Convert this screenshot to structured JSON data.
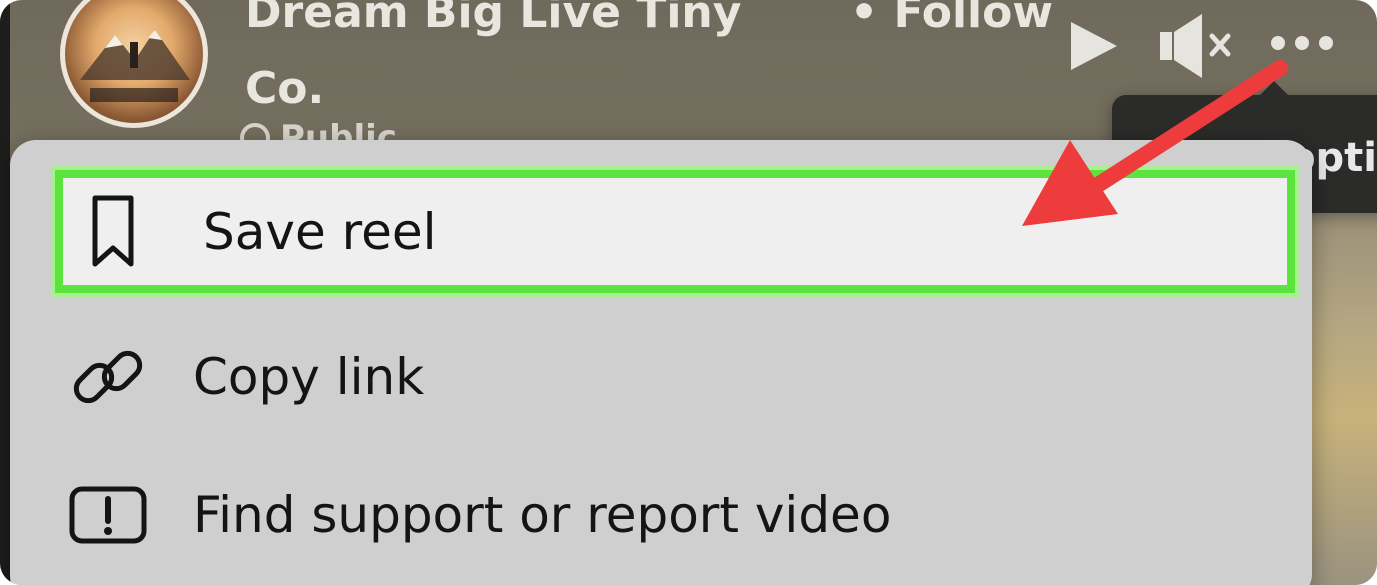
{
  "post_header": {
    "page_name": "Dream Big Live Tiny\nCo.",
    "follow_label": "• Follow",
    "audience": "Public"
  },
  "controls": {
    "play_icon": "play-icon",
    "mute_icon": "muted-speaker-icon",
    "more_icon": "more-options-icon"
  },
  "tooltip": {
    "text": "More options"
  },
  "menu": {
    "items": [
      {
        "label": "Save reel",
        "icon": "bookmark-icon",
        "highlighted": true
      },
      {
        "label": "Copy link",
        "icon": "link-icon",
        "highlighted": false
      },
      {
        "label": "Find support or report video",
        "icon": "report-icon",
        "highlighted": false
      }
    ]
  },
  "annotation": {
    "highlight_color": "#5de33e",
    "arrow_color": "#ee3b3b"
  }
}
